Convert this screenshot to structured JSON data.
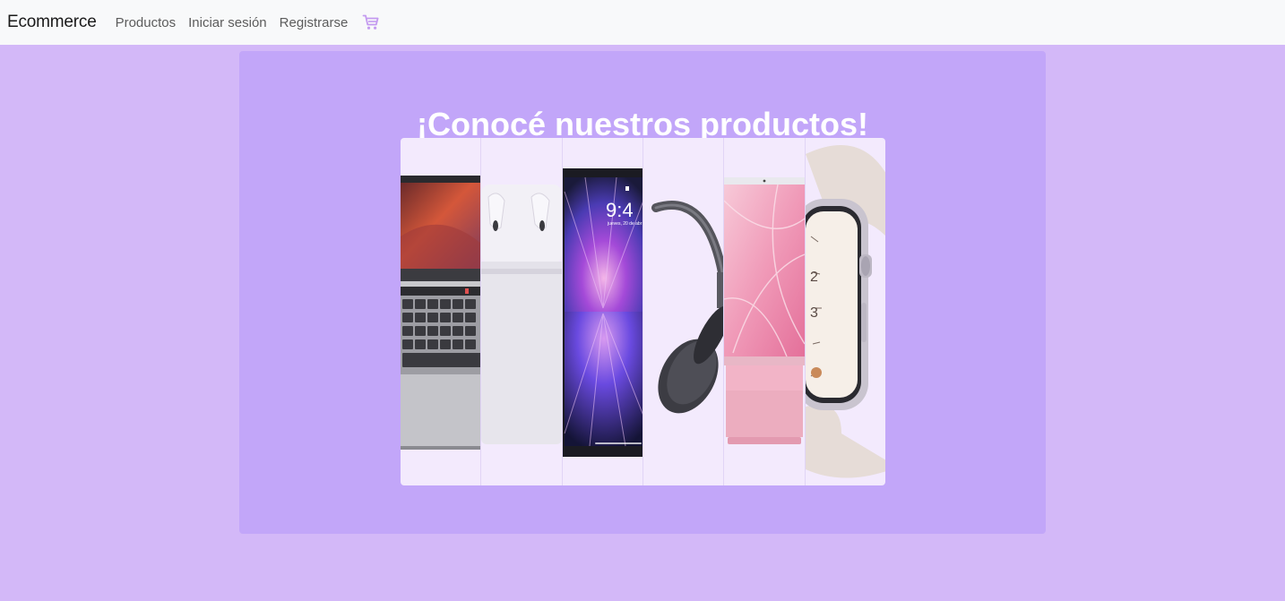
{
  "navbar": {
    "brand": "Ecommerce",
    "links": [
      "Productos",
      "Iniciar sesión",
      "Registrarse"
    ],
    "cart_icon": "cart-icon",
    "cart_color": "#c49bf0"
  },
  "hero": {
    "title": "¡Conocé nuestros productos!",
    "background": "#c2a6f9",
    "page_background": "#d3b8f8",
    "products": [
      {
        "name": "laptop-image",
        "screen_text": ""
      },
      {
        "name": "earbuds-image",
        "screen_text": ""
      },
      {
        "name": "tablet-image",
        "screen_text": "9:4",
        "screen_subtext": "jueves, 20 de abr"
      },
      {
        "name": "headphones-image",
        "screen_text": ""
      },
      {
        "name": "desktop-monitor-image",
        "screen_text": ""
      },
      {
        "name": "smartwatch-image",
        "screen_text": ""
      }
    ]
  }
}
